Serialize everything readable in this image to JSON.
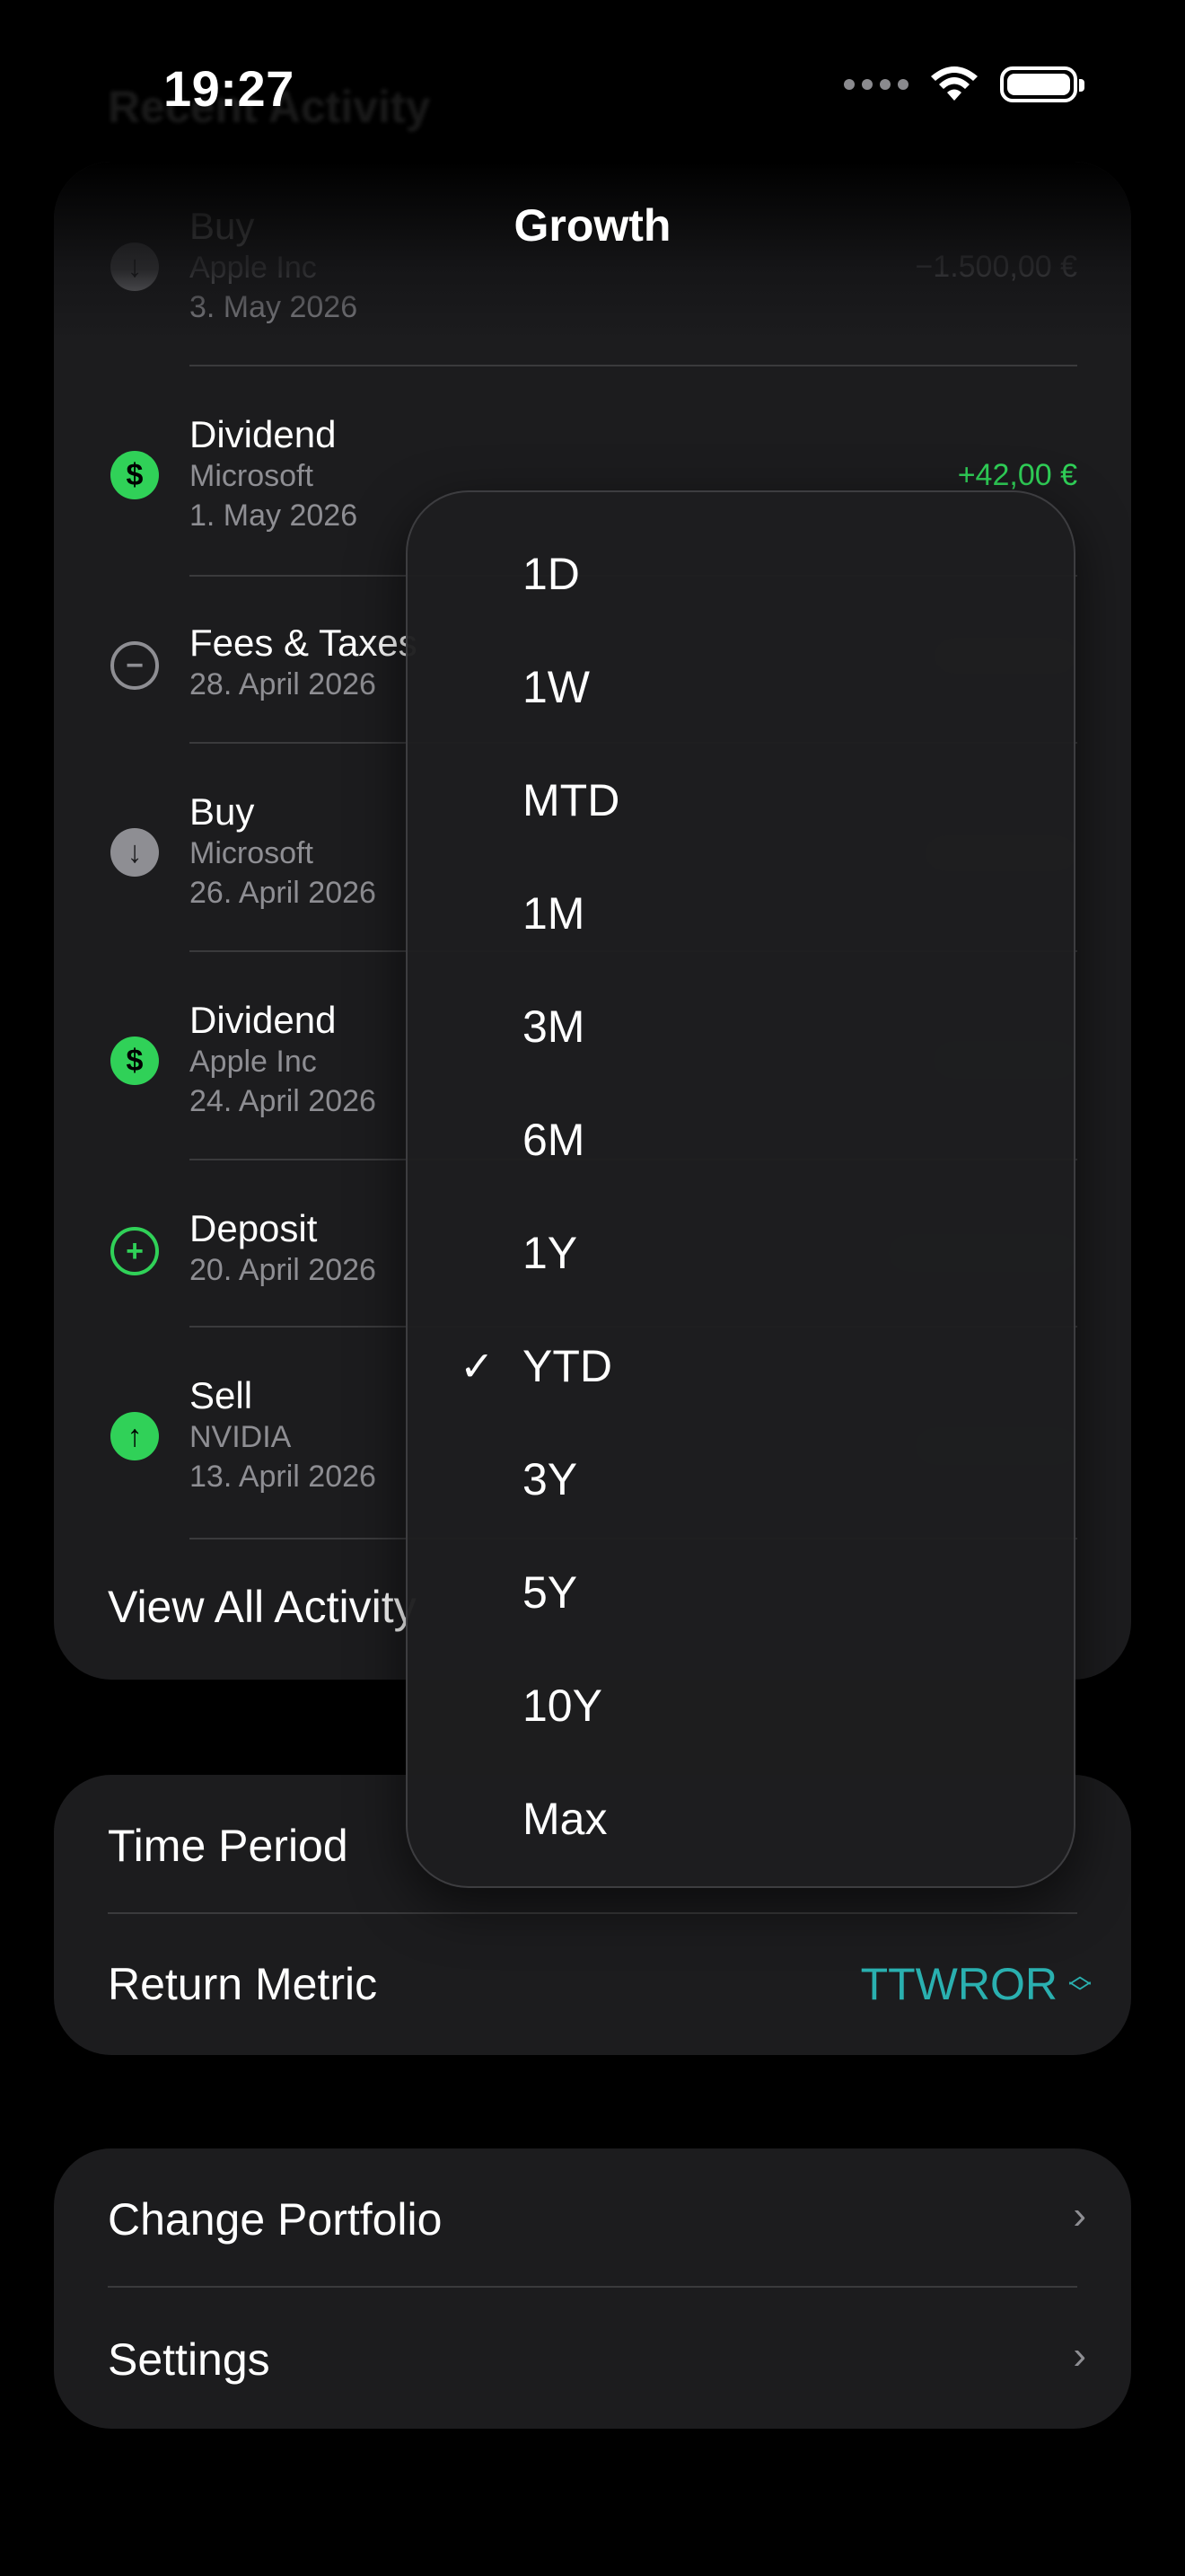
{
  "status_bar": {
    "time": "19:27"
  },
  "faded_heading": "Recent Activity",
  "nav_title": "Growth",
  "activities": [
    {
      "title": "Buy",
      "subtitle": "Apple Inc",
      "date": "3. May 2026",
      "amount": "−1.500,00 €",
      "icon": "arrow-down-icon",
      "amount_color": "#8e8e93"
    },
    {
      "title": "Dividend",
      "subtitle": "Microsoft",
      "date": "1. May 2026",
      "amount": "+42,00 €",
      "icon": "dollar-icon",
      "amount_color": "#30d158"
    },
    {
      "title": "Fees & Taxes",
      "subtitle": "",
      "date": "28. April 2026",
      "amount": "",
      "icon": "minus-circle-icon"
    },
    {
      "title": "Buy",
      "subtitle": "Microsoft",
      "date": "26. April 2026",
      "amount": "",
      "icon": "arrow-down-icon"
    },
    {
      "title": "Dividend",
      "subtitle": "Apple Inc",
      "date": "24. April 2026",
      "amount": "",
      "icon": "dollar-icon"
    },
    {
      "title": "Deposit",
      "subtitle": "",
      "date": "20. April 2026",
      "amount": "",
      "icon": "plus-circle-icon"
    },
    {
      "title": "Sell",
      "subtitle": "NVIDIA",
      "date": "13. April 2026",
      "amount": "",
      "icon": "arrow-up-icon"
    }
  ],
  "view_all_label": "View All Activity",
  "settings_group_a": {
    "time_period_label": "Time Period",
    "return_metric_label": "Return Metric",
    "return_metric_value": "TTWROR"
  },
  "settings_group_b": {
    "change_portfolio_label": "Change Portfolio",
    "settings_label": "Settings"
  },
  "period_menu": {
    "options": [
      "1D",
      "1W",
      "MTD",
      "1M",
      "3M",
      "6M",
      "1Y",
      "YTD",
      "3Y",
      "5Y",
      "10Y",
      "Max"
    ],
    "selected": "YTD"
  },
  "colors": {
    "accent_teal": "#2ab0b0",
    "positive_green": "#30d158",
    "card_bg": "#1c1c1e"
  }
}
